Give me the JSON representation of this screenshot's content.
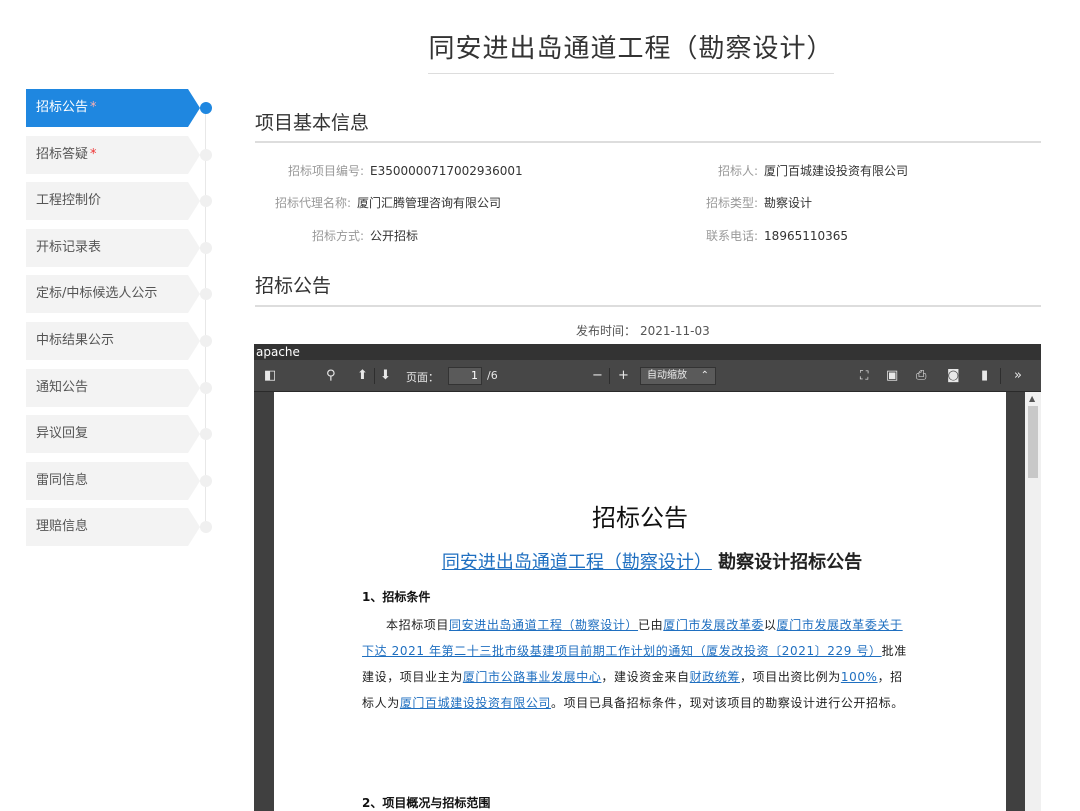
{
  "page_title": "同安进出岛通道工程（勘察设计）",
  "sidebar": {
    "items": [
      {
        "label": "招标公告",
        "required": true,
        "active": true
      },
      {
        "label": "招标答疑",
        "required": true,
        "active": false
      },
      {
        "label": "工程控制价",
        "required": false,
        "active": false
      },
      {
        "label": "开标记录表",
        "required": false,
        "active": false
      },
      {
        "label": "定标/中标候选人公示",
        "required": false,
        "active": false
      },
      {
        "label": "中标结果公示",
        "required": false,
        "active": false
      },
      {
        "label": "通知公告",
        "required": false,
        "active": false
      },
      {
        "label": "异议回复",
        "required": false,
        "active": false
      },
      {
        "label": "雷同信息",
        "required": false,
        "active": false
      },
      {
        "label": "理赔信息",
        "required": false,
        "active": false
      }
    ],
    "required_mark": "*"
  },
  "basic_info": {
    "title": "项目基本信息",
    "fields": {
      "project_no_label": "招标项目编号:",
      "project_no": "E3500000717002936001",
      "tenderer_label": "招标人:",
      "tenderer": "厦门百城建设投资有限公司",
      "agency_label": "招标代理名称:",
      "agency": "厦门汇腾管理咨询有限公司",
      "type_label": "招标类型:",
      "type": "勘察设计",
      "method_label": "招标方式:",
      "method": "公开招标",
      "phone_label": "联系电话:",
      "phone": "18965110365"
    }
  },
  "announcement": {
    "title": "招标公告",
    "publish_label": "发布时间：",
    "publish_date": "2021-11-03"
  },
  "viewer": {
    "apache_label": "apache",
    "page_label": "页面：",
    "page_current": "1",
    "page_total": "/6",
    "zoom": "自动缩放",
    "icons": [
      "sidebar-toggle-icon",
      "search-icon",
      "prev-page-icon",
      "next-page-icon",
      "zoom-out-icon",
      "zoom-in-icon",
      "presentation-icon",
      "open-file-icon",
      "print-icon",
      "download-icon",
      "bookmark-icon",
      "tools-icon"
    ]
  },
  "document": {
    "heading": "招标公告",
    "subheading_link": "同安进出岛通道工程（勘察设计）",
    "subheading_rest": "勘察设计招标公告",
    "section1": "1、招标条件",
    "p1": "本招标项目",
    "p1_link1": "同安进出岛通道工程（勘察设计）",
    "p1_b": "已由",
    "p1_link2": "厦门市发展改革委",
    "p1_c": "以",
    "p1_link3": "厦门市发展改革委关于下达 2021 年第二十三批市级基建项目前期工作计划的通知（厦发改投资〔2021〕229 号）",
    "p1_d": "批准建设，项目业主为",
    "p1_link4": "厦门市公路事业发展中心",
    "p1_e": "，建设资金来自",
    "p1_link5": "财政统筹",
    "p1_f": "，项目出资比例为",
    "p1_link6": "100%",
    "p1_g": "，招标人为",
    "p1_link7": "厦门百城建设投资有限公司",
    "p1_h": "。项目已具备招标条件，现对该项目的勘察设计进行公开招标。",
    "section2": "2、项目概况与招标范围"
  }
}
